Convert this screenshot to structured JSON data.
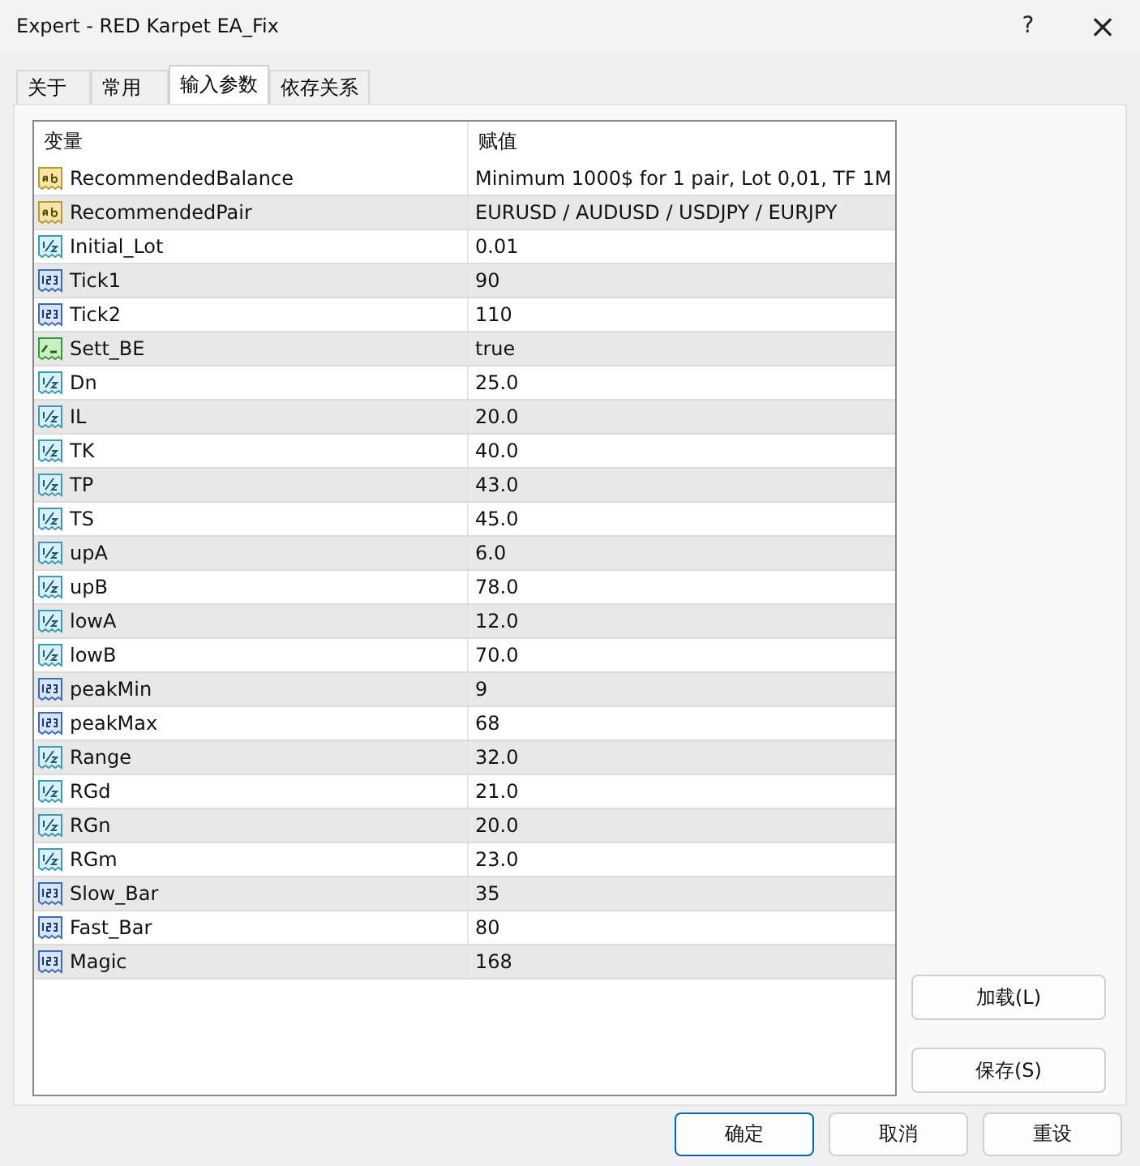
{
  "window": {
    "title": "Expert - RED Karpet EA_Fix",
    "help": "?",
    "close": "×"
  },
  "tabs": [
    {
      "label": "关于",
      "selected": false
    },
    {
      "label": "常用",
      "selected": false
    },
    {
      "label": "输入参数",
      "selected": true
    },
    {
      "label": "依存关系",
      "selected": false
    }
  ],
  "table": {
    "columns": [
      "变量",
      "赋值"
    ],
    "rows": [
      {
        "kind": "string",
        "name": "RecommendedBalance",
        "value": "Minimum 1000$ for 1 pair, Lot 0,01, TF 1M"
      },
      {
        "kind": "string",
        "name": "RecommendedPair",
        "value": "EURUSD / AUDUSD / USDJPY / EURJPY"
      },
      {
        "kind": "double",
        "name": "Initial_Lot",
        "value": "0.01"
      },
      {
        "kind": "int",
        "name": "Tick1",
        "value": "90"
      },
      {
        "kind": "int",
        "name": "Tick2",
        "value": "110"
      },
      {
        "kind": "bool",
        "name": "Sett_BE",
        "value": "true"
      },
      {
        "kind": "double",
        "name": "Dn",
        "value": "25.0"
      },
      {
        "kind": "double",
        "name": "IL",
        "value": "20.0"
      },
      {
        "kind": "double",
        "name": "TK",
        "value": "40.0"
      },
      {
        "kind": "double",
        "name": "TP",
        "value": "43.0"
      },
      {
        "kind": "double",
        "name": "TS",
        "value": "45.0"
      },
      {
        "kind": "double",
        "name": "upA",
        "value": "6.0"
      },
      {
        "kind": "double",
        "name": "upB",
        "value": "78.0"
      },
      {
        "kind": "double",
        "name": "lowA",
        "value": "12.0"
      },
      {
        "kind": "double",
        "name": "lowB",
        "value": "70.0"
      },
      {
        "kind": "int",
        "name": "peakMin",
        "value": "9"
      },
      {
        "kind": "int",
        "name": "peakMax",
        "value": "68"
      },
      {
        "kind": "double",
        "name": "Range",
        "value": "32.0"
      },
      {
        "kind": "double",
        "name": "RGd",
        "value": "21.0"
      },
      {
        "kind": "double",
        "name": "RGn",
        "value": "20.0"
      },
      {
        "kind": "double",
        "name": "RGm",
        "value": "23.0"
      },
      {
        "kind": "int",
        "name": "Slow_Bar",
        "value": "35"
      },
      {
        "kind": "int",
        "name": "Fast_Bar",
        "value": "80"
      },
      {
        "kind": "int",
        "name": "Magic",
        "value": "168"
      }
    ]
  },
  "side_buttons": [
    "加载(L)",
    "保存(S)"
  ],
  "buttons": [
    {
      "label": "确定",
      "default": true
    },
    {
      "label": "取消",
      "default": false
    },
    {
      "label": "重设",
      "default": false
    }
  ]
}
